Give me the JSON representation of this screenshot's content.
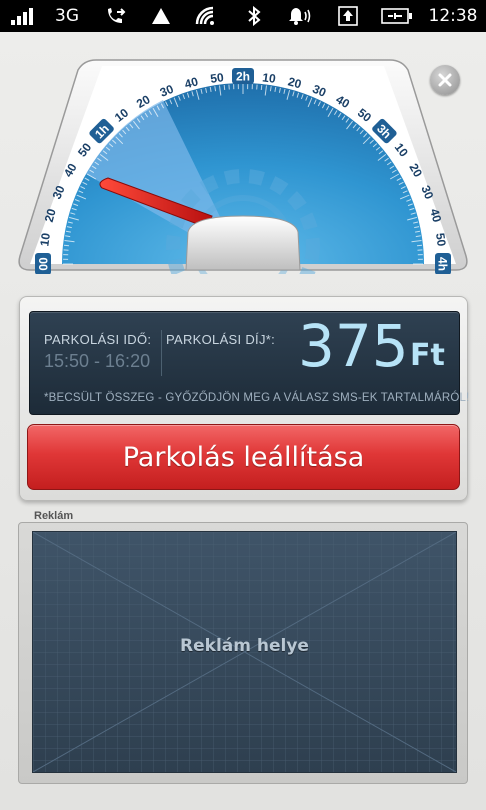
{
  "status_bar": {
    "network": "3G",
    "time": "12:38"
  },
  "gauge": {
    "left_labels": [
      "00",
      "10",
      "20",
      "30",
      "40",
      "50"
    ],
    "hour_1": "1h",
    "mid_labels_1": [
      "10",
      "20",
      "30",
      "40",
      "50"
    ],
    "hour_2": "2h",
    "mid_labels_2": [
      "10",
      "20",
      "30",
      "40",
      "50"
    ],
    "hour_3": "3h",
    "right_labels": [
      "10",
      "20",
      "30",
      "40",
      "50"
    ],
    "hour_4": "4h",
    "needle_minutes": 40
  },
  "parking": {
    "time_label": "PARKOLÁSI IDŐ:",
    "time_value": "15:50 - 16:20",
    "fee_label": "PARKOLÁSI DÍJ*:",
    "fee_amount": "375",
    "fee_currency": "Ft",
    "note": "*BECSÜLT ÖSSZEG - GYŐZŐDJÖN MEG A VÁLASZ SMS-EK TARTALMÁRÓL!",
    "stop_button": "Parkolás leállítása"
  },
  "ad": {
    "title": "Reklám",
    "placeholder": "Reklám helye"
  },
  "colors": {
    "accent_red": "#d92b2b",
    "display_bg": "#24333f",
    "gauge_blue": "#2e8fc9",
    "price_text": "#b7e3f7"
  }
}
